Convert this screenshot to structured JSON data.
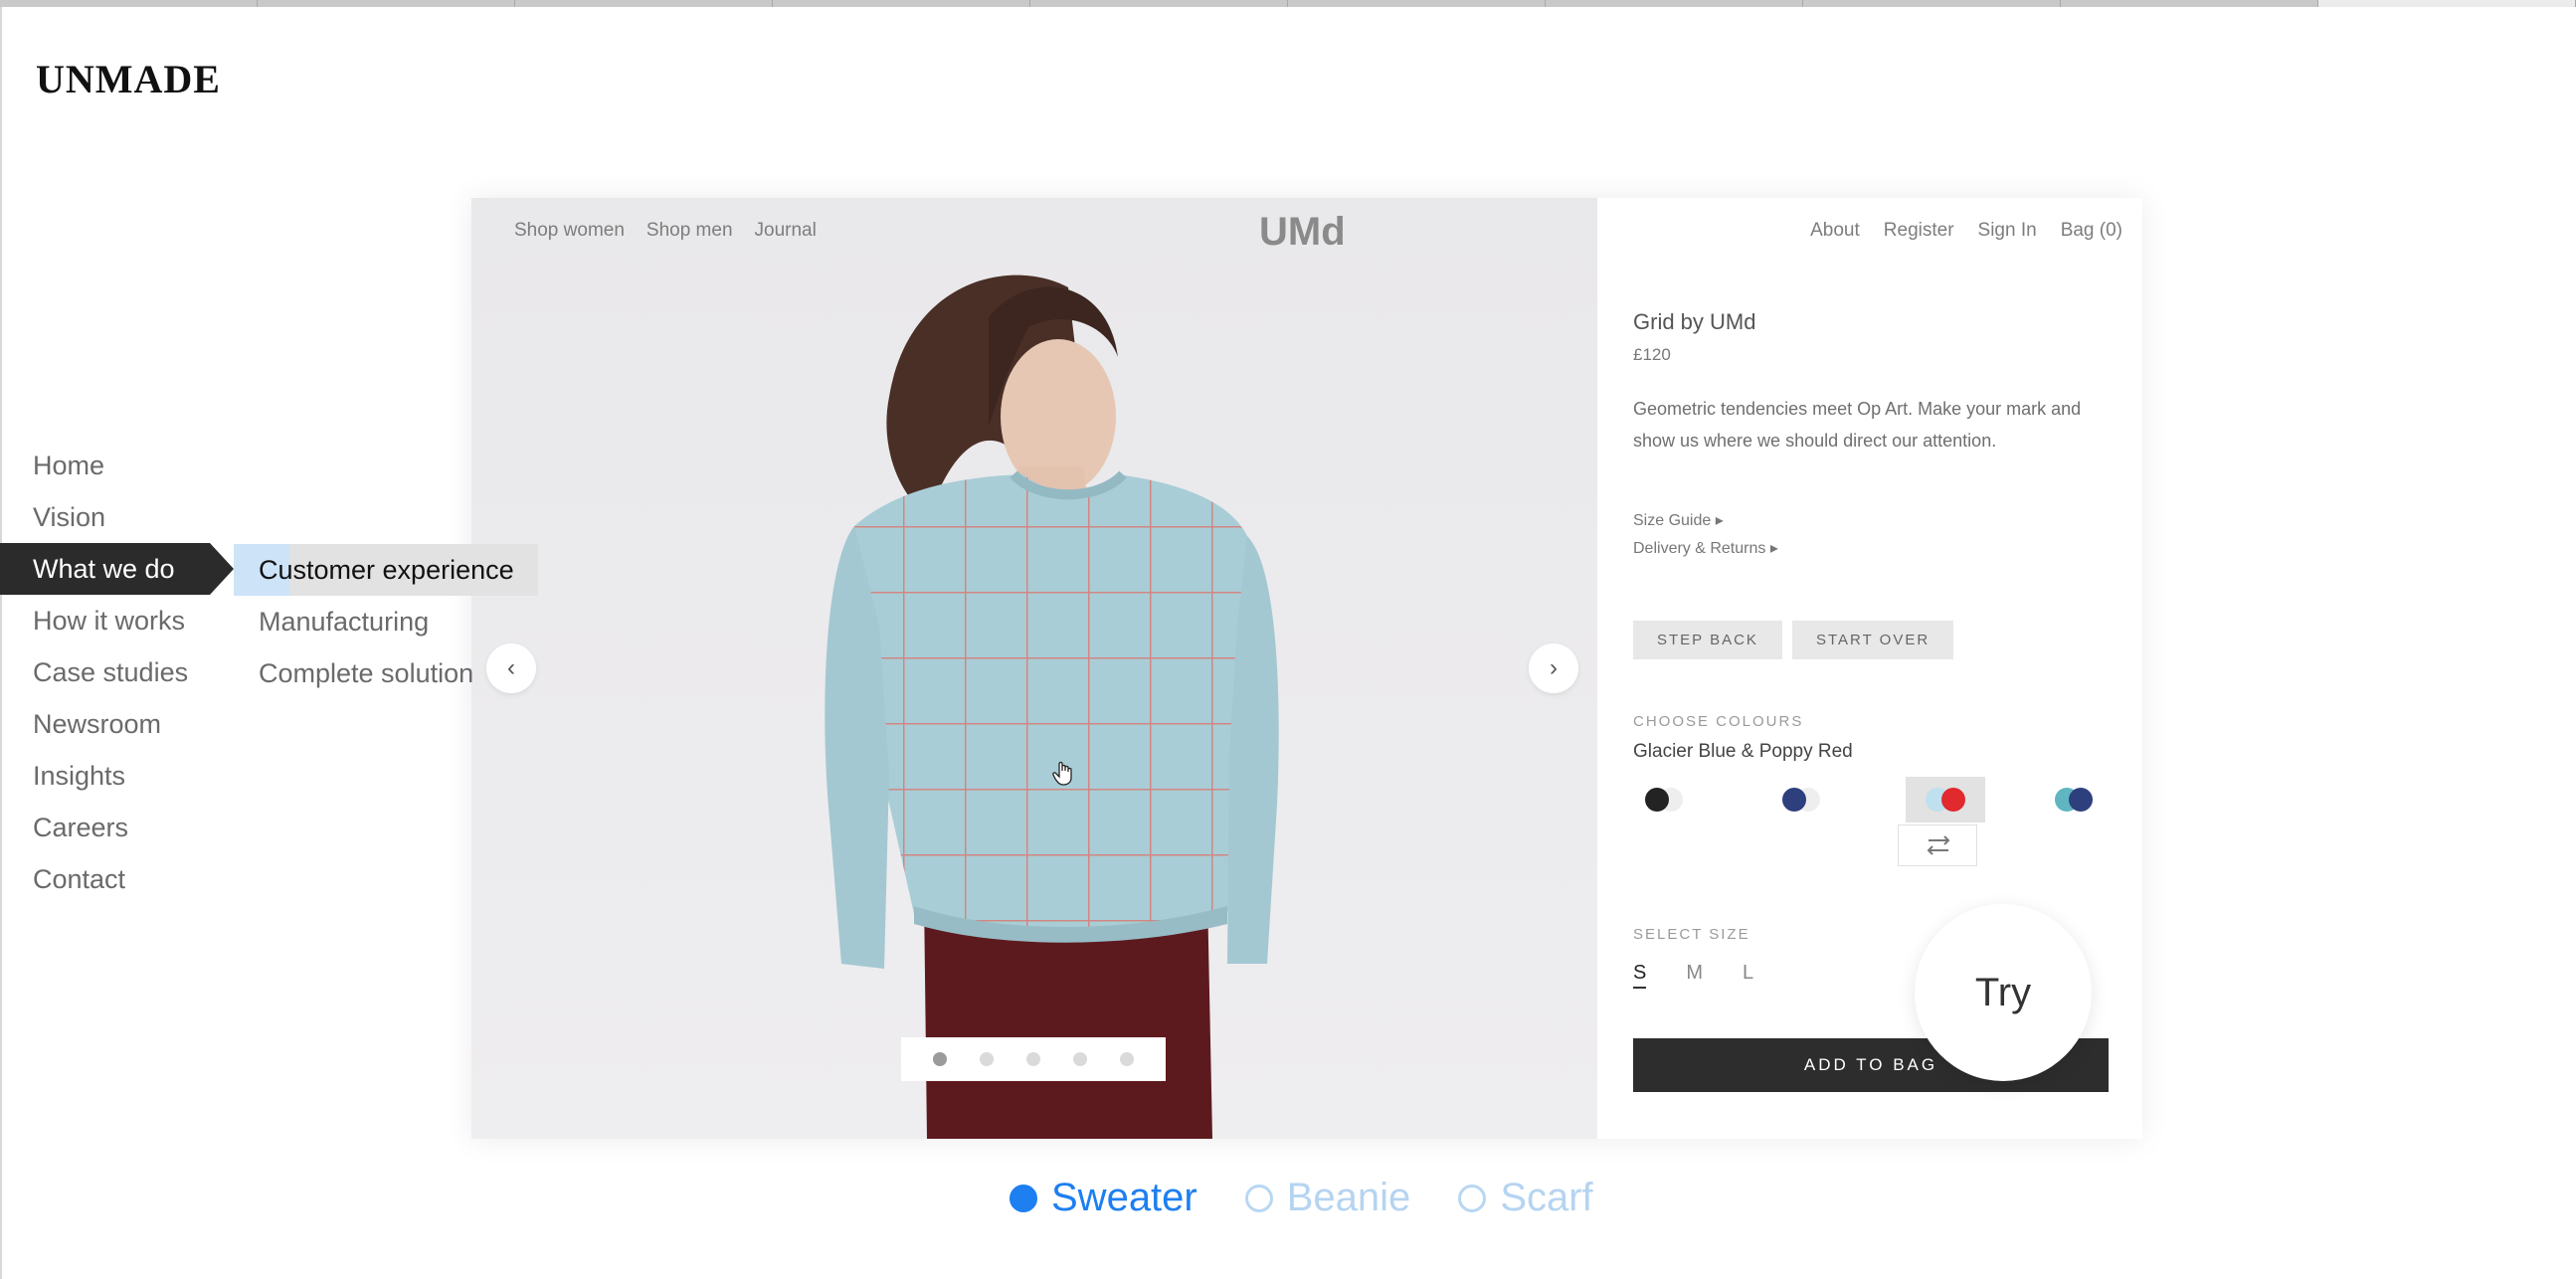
{
  "brand": "UNMADE",
  "nav": {
    "items": [
      "Home",
      "Vision",
      "What we do",
      "How it works",
      "Case studies",
      "Newsroom",
      "Insights",
      "Careers",
      "Contact"
    ],
    "active_index": 2,
    "subitems": [
      "Customer experience",
      "Manufacturing",
      "Complete solution"
    ],
    "active_sub_index": 0
  },
  "shop": {
    "nav_left": [
      "Shop women",
      "Shop men",
      "Journal"
    ],
    "logo": "UMd",
    "nav_right": [
      "About",
      "Register",
      "Sign In",
      "Bag (0)"
    ],
    "carousel_dots": 5,
    "active_dot": 0,
    "product": {
      "title": "Grid by UMd",
      "price": "£120",
      "description": "Geometric tendencies meet Op Art. Make your mark and show us where we should direct our attention.",
      "size_guide": "Size Guide ▸",
      "delivery": "Delivery & Returns ▸",
      "step_back": "STEP BACK",
      "start_over": "START OVER",
      "choose_colours": "CHOOSE COLOURS",
      "colour_name": "Glacier Blue & Poppy Red",
      "swatches": [
        {
          "a": "#232323",
          "b": "#eeeeee"
        },
        {
          "a": "#2e3f7e",
          "b": "#eeeeee"
        },
        {
          "a": "#bfe0ef",
          "b": "#e02a2e"
        },
        {
          "a": "#5fb5c0",
          "b": "#2e3f7e"
        }
      ],
      "selected_swatch": 2,
      "select_size": "SELECT SIZE",
      "sizes": [
        "S",
        "M",
        "L"
      ],
      "selected_size": 0,
      "add_to_bag": "ADD TO BAG"
    },
    "try_label": "Try"
  },
  "options": [
    {
      "label": "Sweater",
      "selected": true
    },
    {
      "label": "Beanie",
      "selected": false
    },
    {
      "label": "Scarf",
      "selected": false
    }
  ]
}
